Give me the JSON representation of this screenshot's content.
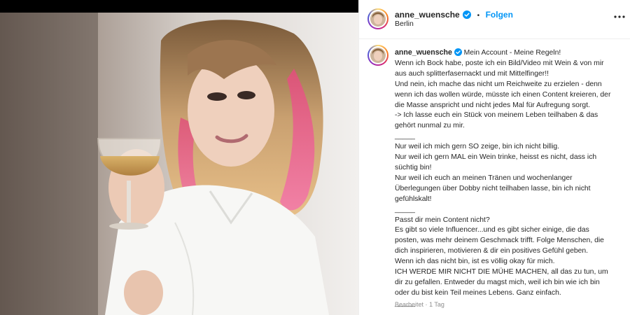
{
  "header": {
    "username": "anne_wuensche",
    "separator": "•",
    "follow_label": "Folgen",
    "location": "Berlin"
  },
  "caption": {
    "username": "anne_wuensche",
    "first_line": "Mein Account - Meine Regeln!",
    "text": "Wenn ich Bock habe, poste ich ein Bild/Video mit Wein & von mir aus auch splitterfasernackt und mit Mittelfinger!!\nUnd nein, ich mache das nicht um Reichweite zu erzielen - denn wenn ich das wollen würde, müsste ich einen Content kreieren, der die Masse anspricht und nicht jedes Mal für Aufregung sorgt.\n-> Ich lasse euch ein Stück von meinem Leben teilhaben & das gehört nunmal zu mir.\n_____\nNur weil ich mich gern SO zeige, bin ich nicht billig.\nNur weil ich gern MAL ein Wein trinke, heisst es nicht, dass ich süchtig bin!\nNur weil ich euch an meinen Tränen und wochenlanger Überlegungen über Dobby nicht teilhaben lasse, bin ich nicht gefühlskalt!\n_____\nPasst dir mein Content nicht?\nEs gibt so viele Influencer...und es gibt sicher einige, die das posten, was mehr deinem Geschmack trifft. Folge Menschen, die dich inspirieren, motivieren & dir ein positives Gefühl geben.\nWenn ich das nicht bin, ist es völlig okay für mich.\nICH WERDE MIR NICHT DIE MÜHE MACHEN, all das zu tun, um dir zu gefallen. Entweder du magst mich, weil ich bin wie ich bin oder du bist kein Teil meines Lebens. Ganz einfach.\n_____"
  },
  "meta": {
    "edited": "Bearbeitet",
    "separator": "·",
    "age": "1 Tag"
  },
  "colors": {
    "accent": "#0095f6",
    "verified": "#0095f6",
    "muted": "#8e8e8e"
  },
  "icons": {
    "verified": "verified-badge-icon",
    "more": "more-options-icon"
  }
}
